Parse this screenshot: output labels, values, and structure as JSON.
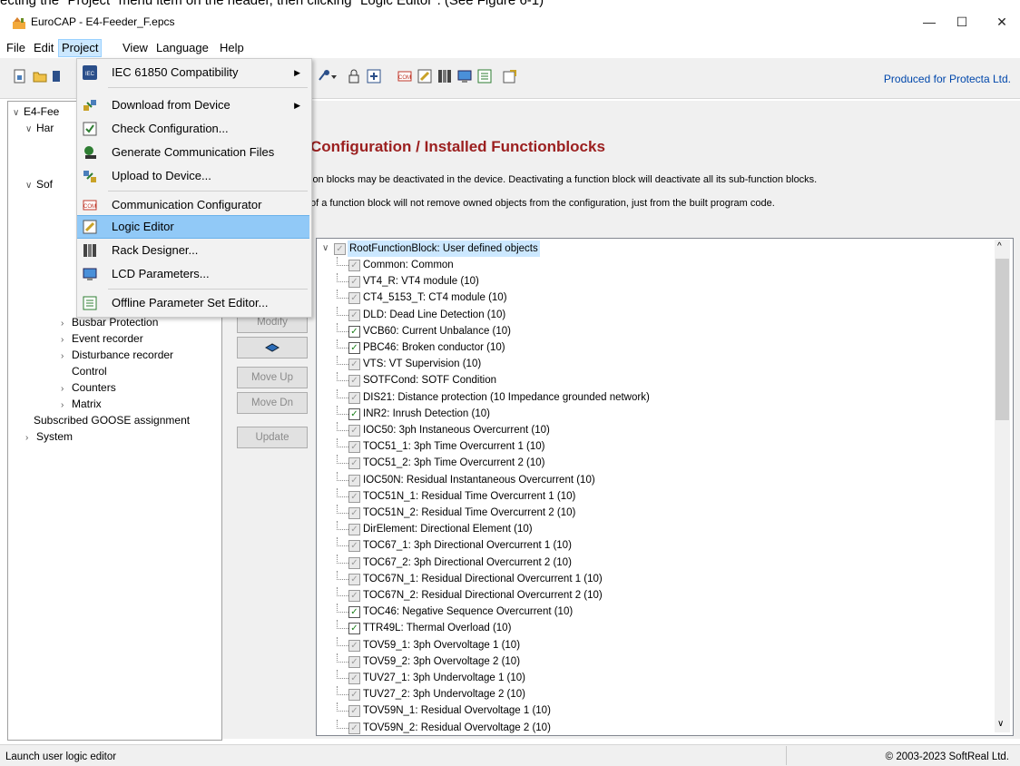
{
  "top_note": "ecting the \"Project\" menu item on the header, then clicking \"Logic Editor\". (See Figure 6-1)",
  "window": {
    "title": "EuroCAP - E4-Feeder_F.epcs",
    "minimize": "—",
    "maximize": "☐",
    "close": "✕"
  },
  "menubar": [
    "File",
    "Edit",
    "Project",
    "View",
    "Language",
    "Help"
  ],
  "toolbar": {
    "produced": "Produced for Protecta Ltd."
  },
  "project_menu": {
    "items": [
      {
        "label": "IEC 61850 Compatibility",
        "icon": "iec-icon",
        "submenu": true
      },
      {
        "label": "Download from Device",
        "icon": "download-icon",
        "submenu": true
      },
      {
        "label": "Check Configuration...",
        "icon": "check-config-icon"
      },
      {
        "label": "Generate Communication Files",
        "icon": "generate-comm-icon"
      },
      {
        "label": "Upload to Device...",
        "icon": "upload-icon"
      },
      {
        "label": "Communication Configurator",
        "icon": "com-configurator-icon"
      },
      {
        "label": "Logic Editor",
        "icon": "logic-editor-icon"
      },
      {
        "label": "Rack Designer...",
        "icon": "rack-designer-icon"
      },
      {
        "label": "LCD Parameters...",
        "icon": "lcd-icon"
      },
      {
        "label": "Offline Parameter Set Editor...",
        "icon": "offline-parameter-icon"
      }
    ],
    "highlighted": "Logic Editor"
  },
  "tree": {
    "root": "E4-Fee",
    "har": "Har",
    "sof": "Sof",
    "items": [
      "Busbar Protection",
      "Event recorder",
      "Disturbance recorder",
      "Control",
      "Counters",
      "Matrix",
      "Subscribed GOOSE assignment",
      "System"
    ]
  },
  "main": {
    "heading": "Configuration / Installed Functionblocks",
    "note1": "ion blocks may be deactivated in the device. Deactivating a function block will deactivate all its sub-function blocks.",
    "note2": "of a function block will not remove owned objects from the configuration, just from the built program code.",
    "buttons": {
      "modify": "Modify",
      "move_up": "Move Up",
      "move_dn": "Move Dn",
      "update": "Update"
    }
  },
  "function_blocks": {
    "root": "RootFunctionBlock: User defined objects",
    "items": [
      {
        "label": "Common: Common",
        "checked": false
      },
      {
        "label": "VT4_R: VT4 module (10)",
        "checked": false
      },
      {
        "label": "CT4_5153_T: CT4 module (10)",
        "checked": false
      },
      {
        "label": "DLD: Dead Line Detection (10)",
        "checked": false
      },
      {
        "label": "VCB60: Current Unbalance (10)",
        "checked": true
      },
      {
        "label": "PBC46: Broken conductor (10)",
        "checked": true
      },
      {
        "label": "VTS: VT Supervision (10)",
        "checked": false
      },
      {
        "label": "SOTFCond: SOTF Condition",
        "checked": false
      },
      {
        "label": "DIS21: Distance protection (10 Impedance grounded network)",
        "checked": false
      },
      {
        "label": "INR2: Inrush Detection (10)",
        "checked": true
      },
      {
        "label": "IOC50: 3ph Instaneous Overcurrent (10)",
        "checked": false
      },
      {
        "label": "TOC51_1: 3ph Time Overcurrent 1 (10)",
        "checked": false
      },
      {
        "label": "TOC51_2: 3ph Time Overcurrent 2 (10)",
        "checked": false
      },
      {
        "label": "IOC50N: Residual Instantaneous Overcurrent (10)",
        "checked": false
      },
      {
        "label": "TOC51N_1: Residual Time Overcurrent 1 (10)",
        "checked": false
      },
      {
        "label": "TOC51N_2: Residual Time Overcurrent 2 (10)",
        "checked": false
      },
      {
        "label": "DirElement: Directional Element (10)",
        "checked": false
      },
      {
        "label": "TOC67_1: 3ph Directional Overcurrent 1 (10)",
        "checked": false
      },
      {
        "label": "TOC67_2: 3ph Directional Overcurrent 2 (10)",
        "checked": false
      },
      {
        "label": "TOC67N_1: Residual Directional Overcurrent 1 (10)",
        "checked": false
      },
      {
        "label": "TOC67N_2: Residual Directional Overcurrent 2 (10)",
        "checked": false
      },
      {
        "label": "TOC46: Negative Sequence Overcurrent (10)",
        "checked": true
      },
      {
        "label": "TTR49L: Thermal Overload (10)",
        "checked": true
      },
      {
        "label": "TOV59_1: 3ph Overvoltage 1 (10)",
        "checked": false
      },
      {
        "label": "TOV59_2: 3ph Overvoltage 2 (10)",
        "checked": false
      },
      {
        "label": "TUV27_1: 3ph Undervoltage 1 (10)",
        "checked": false
      },
      {
        "label": "TUV27_2: 3ph Undervoltage 2 (10)",
        "checked": false
      },
      {
        "label": "TOV59N_1: Residual Overvoltage 1 (10)",
        "checked": false
      },
      {
        "label": "TOV59N_2: Residual Overvoltage 2 (10)",
        "checked": false
      }
    ]
  },
  "statusbar": {
    "left": "Launch user logic editor",
    "right": "© 2003-2023 SoftReal Ltd."
  },
  "colors": {
    "heading": "#9b1f1f",
    "produced": "#0047ab",
    "menu_highlight": "#91c9f7",
    "check_green": "#1a7f1a"
  }
}
